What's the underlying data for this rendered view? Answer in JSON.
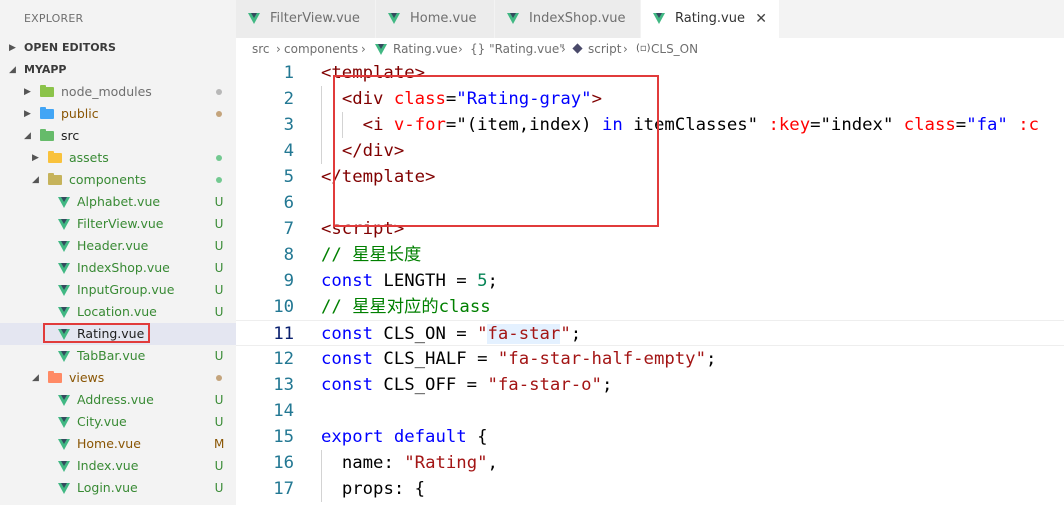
{
  "sidebar": {
    "title": "EXPLORER",
    "sections": {
      "open_editors": "OPEN EDITORS",
      "project": "MYAPP"
    },
    "tree": [
      {
        "label": "node_modules",
        "kind": "folder",
        "icon": "folder-green-icon",
        "level": 1,
        "chevron": "right",
        "status": "gray"
      },
      {
        "label": "public",
        "kind": "folder",
        "icon": "folder-blue-icon",
        "level": 1,
        "chevron": "right",
        "status": "brown-dot"
      },
      {
        "label": "src",
        "kind": "folder",
        "icon": "folder-green-open-icon",
        "level": 1,
        "chevron": "down",
        "status": ""
      },
      {
        "label": "assets",
        "kind": "folder",
        "icon": "folder-yellow-icon",
        "level": 2,
        "chevron": "right",
        "status": "green-dot"
      },
      {
        "label": "components",
        "kind": "folder",
        "icon": "folder-yellow-open-icon",
        "level": 2,
        "chevron": "down",
        "status": "green-dot"
      },
      {
        "label": "Alphabet.vue",
        "kind": "file",
        "level": 3,
        "badge": "U"
      },
      {
        "label": "FilterView.vue",
        "kind": "file",
        "level": 3,
        "badge": "U"
      },
      {
        "label": "Header.vue",
        "kind": "file",
        "level": 3,
        "badge": "U"
      },
      {
        "label": "IndexShop.vue",
        "kind": "file",
        "level": 3,
        "badge": "U"
      },
      {
        "label": "InputGroup.vue",
        "kind": "file",
        "level": 3,
        "badge": "U"
      },
      {
        "label": "Location.vue",
        "kind": "file",
        "level": 3,
        "badge": "U"
      },
      {
        "label": "Rating.vue",
        "kind": "file",
        "level": 3,
        "badge": "",
        "selected": true
      },
      {
        "label": "TabBar.vue",
        "kind": "file",
        "level": 3,
        "badge": "U"
      },
      {
        "label": "views",
        "kind": "folder",
        "icon": "folder-orange-open-icon",
        "level": 2,
        "chevron": "down",
        "status": "brown-dot"
      },
      {
        "label": "Address.vue",
        "kind": "file",
        "level": 3,
        "badge": "U"
      },
      {
        "label": "City.vue",
        "kind": "file",
        "level": 3,
        "badge": "U"
      },
      {
        "label": "Home.vue",
        "kind": "file",
        "level": 3,
        "badge": "M"
      },
      {
        "label": "Index.vue",
        "kind": "file",
        "level": 3,
        "badge": "U"
      },
      {
        "label": "Login.vue",
        "kind": "file",
        "level": 3,
        "badge": "U"
      }
    ]
  },
  "tabs": [
    {
      "label": "FilterView.vue",
      "active": false
    },
    {
      "label": "Home.vue",
      "active": false
    },
    {
      "label": "IndexShop.vue",
      "active": false
    },
    {
      "label": "Rating.vue",
      "active": true
    }
  ],
  "tab_close_glyph": "✕",
  "breadcrumb": {
    "parts": [
      "src",
      "components",
      "Rating.vue",
      "{} \"Rating.vue\"",
      "script",
      "CLS_ON"
    ],
    "separator": "›"
  },
  "editor": {
    "current_line": 11,
    "lines": [
      {
        "n": "1",
        "indent": 0,
        "tokens": [
          [
            "tk-tag",
            "<template>"
          ]
        ]
      },
      {
        "n": "2",
        "indent": 1,
        "tokens": [
          [
            "tk-tag",
            "<div "
          ],
          [
            "tk-attr",
            "class"
          ],
          [
            "",
            "="
          ],
          [
            "tk-str",
            "\"Rating-gray\""
          ],
          [
            "tk-tag",
            ">"
          ]
        ]
      },
      {
        "n": "3",
        "indent": 2,
        "tokens": [
          [
            "tk-tag",
            "<i "
          ],
          [
            "tk-attr",
            "v-for"
          ],
          [
            "",
            "=\"(item,index) "
          ],
          [
            "tk-kw",
            "in"
          ],
          [
            "",
            " itemClasses\" "
          ],
          [
            "tk-attr",
            ":key"
          ],
          [
            "",
            "="
          ],
          [
            "",
            "\"index\" "
          ],
          [
            "tk-attr",
            "class"
          ],
          [
            "",
            "="
          ],
          [
            "tk-str",
            "\"fa\" "
          ],
          [
            "tk-attr",
            ":c"
          ]
        ]
      },
      {
        "n": "4",
        "indent": 1,
        "tokens": [
          [
            "tk-tag",
            "</div>"
          ]
        ]
      },
      {
        "n": "5",
        "indent": 0,
        "tokens": [
          [
            "tk-tag",
            "</template>"
          ]
        ]
      },
      {
        "n": "6",
        "indent": 0,
        "tokens": []
      },
      {
        "n": "7",
        "indent": 0,
        "tokens": [
          [
            "tk-tag",
            "<script>"
          ]
        ]
      },
      {
        "n": "8",
        "indent": 0,
        "tokens": [
          [
            "tk-cm",
            "// 星星长度"
          ]
        ]
      },
      {
        "n": "9",
        "indent": 0,
        "tokens": [
          [
            "tk-kw",
            "const"
          ],
          [
            "",
            " LENGTH = "
          ],
          [
            "tk-num",
            "5"
          ],
          [
            "",
            ";"
          ]
        ]
      },
      {
        "n": "10",
        "indent": 0,
        "tokens": [
          [
            "tk-cm",
            "// 星星对应的class"
          ]
        ]
      },
      {
        "n": "11",
        "indent": 0,
        "tokens": [
          [
            "tk-kw",
            "const"
          ],
          [
            "",
            " CLS_ON = "
          ],
          [
            "tk-strR",
            "\""
          ],
          [
            "tk-strR hl",
            "fa-star"
          ],
          [
            "tk-strR",
            "\""
          ],
          [
            "",
            ";"
          ]
        ]
      },
      {
        "n": "12",
        "indent": 0,
        "tokens": [
          [
            "tk-kw",
            "const"
          ],
          [
            "",
            " CLS_HALF = "
          ],
          [
            "tk-strR",
            "\"fa-star-half-empty\""
          ],
          [
            "",
            ";"
          ]
        ]
      },
      {
        "n": "13",
        "indent": 0,
        "tokens": [
          [
            "tk-kw",
            "const"
          ],
          [
            "",
            " CLS_OFF = "
          ],
          [
            "tk-strR",
            "\"fa-star-o\""
          ],
          [
            "",
            ";"
          ]
        ]
      },
      {
        "n": "14",
        "indent": 0,
        "tokens": []
      },
      {
        "n": "15",
        "indent": 0,
        "tokens": [
          [
            "tk-kw",
            "export"
          ],
          [
            "",
            " "
          ],
          [
            "tk-kw",
            "default"
          ],
          [
            "",
            " {"
          ]
        ]
      },
      {
        "n": "16",
        "indent": 1,
        "tokens": [
          [
            "",
            "name: "
          ],
          [
            "tk-strR",
            "\"Rating\""
          ],
          [
            "",
            ","
          ]
        ]
      },
      {
        "n": "17",
        "indent": 1,
        "tokens": [
          [
            "",
            "props: {"
          ]
        ]
      }
    ]
  },
  "colors": {
    "annotation_red": "#e13b3b",
    "vue_green": "#41b883",
    "untracked_green": "#388a34",
    "modified_brown": "#895503"
  }
}
